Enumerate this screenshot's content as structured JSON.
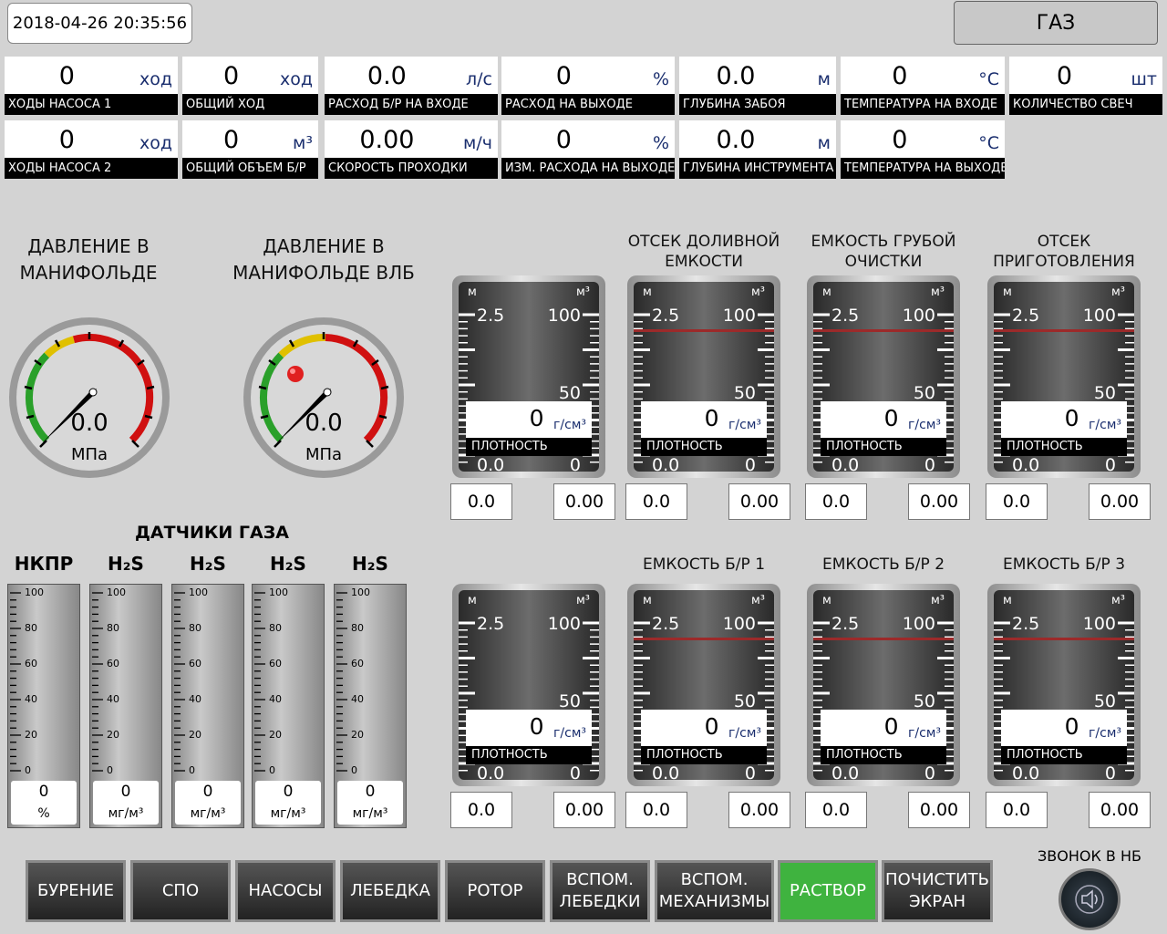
{
  "header": {
    "datetime": "2018-04-26 20:35:56",
    "gas_button": "ГАЗ"
  },
  "tiles_row1": [
    {
      "value": "0",
      "unit": "ход",
      "label": "ХОДЫ НАСОСА 1"
    },
    {
      "value": "0",
      "unit": "ход",
      "label": "ОБЩИЙ ХОД"
    },
    {
      "value": "0.0",
      "unit": "л/с",
      "label": "РАСХОД Б/Р НА ВХОДЕ"
    },
    {
      "value": "0",
      "unit": "%",
      "label": "РАСХОД НА ВЫХОДЕ"
    },
    {
      "value": "0.0",
      "unit": "м",
      "label": "ГЛУБИНА ЗАБОЯ"
    },
    {
      "value": "0",
      "unit": "°C",
      "label": "ТЕМПЕРАТУРА НА ВХОДЕ"
    },
    {
      "value": "0",
      "unit": "шт",
      "label": "КОЛИЧЕСТВО СВЕЧ"
    }
  ],
  "tiles_row2": [
    {
      "value": "0",
      "unit": "ход",
      "label": "ХОДЫ НАСОСА 2"
    },
    {
      "value": "0",
      "unit": "м³",
      "label": "ОБЩИЙ ОБЪЕМ Б/Р"
    },
    {
      "value": "0.00",
      "unit": "м/ч",
      "label": "СКОРОСТЬ ПРОХОДКИ"
    },
    {
      "value": "0",
      "unit": "%",
      "label": "ИЗМ. РАСХОДА НА ВЫХОДЕ"
    },
    {
      "value": "0.0",
      "unit": "м",
      "label": "ГЛУБИНА ИНСТРУМЕНТА"
    },
    {
      "value": "0",
      "unit": "°C",
      "label": "ТЕМПЕРАТУРА НА ВЫХОДЕ"
    }
  ],
  "gauges": [
    {
      "title": "ДАВЛЕНИЕ В МАНИФОЛЬДЕ",
      "value": "0.0",
      "unit": "МПа"
    },
    {
      "title": "ДАВЛЕНИЕ В МАНИФОЛЬДЕ ВЛБ",
      "value": "0.0",
      "unit": "МПа"
    }
  ],
  "tank_common": {
    "unit_left": "м",
    "unit_right": "м³",
    "level_top": "2.5",
    "vol_top": "100",
    "vol_mid": "50",
    "level_bottom": "0.0",
    "vol_bottom": "0",
    "density_unit": "г/см³",
    "density_label": "ПЛОТНОСТЬ"
  },
  "tanks": [
    {
      "title": "",
      "density": "0",
      "level": "0.0",
      "volume": "0.00"
    },
    {
      "title": "ОТСЕК ДОЛИВНОЙ ЕМКОСТИ",
      "density": "0",
      "level": "0.0",
      "volume": "0.00"
    },
    {
      "title": "ЕМКОСТЬ ГРУБОЙ ОЧИСТКИ",
      "density": "0",
      "level": "0.0",
      "volume": "0.00"
    },
    {
      "title": "ОТСЕК ПРИГОТОВЛЕНИЯ",
      "density": "0",
      "level": "0.0",
      "volume": "0.00"
    },
    {
      "title": "",
      "density": "0",
      "level": "0.0",
      "volume": "0.00"
    },
    {
      "title": "ЕМКОСТЬ Б/Р 1",
      "density": "0",
      "level": "0.0",
      "volume": "0.00"
    },
    {
      "title": "ЕМКОСТЬ Б/Р 2",
      "density": "0",
      "level": "0.0",
      "volume": "0.00"
    },
    {
      "title": "ЕМКОСТЬ Б/Р 3",
      "density": "0",
      "level": "0.0",
      "volume": "0.00"
    }
  ],
  "gas_sensors": {
    "title": "ДАТЧИКИ ГАЗА",
    "scale": [
      "100",
      "80",
      "60",
      "40",
      "20",
      "0"
    ],
    "items": [
      {
        "name": "НКПР",
        "value": "0",
        "unit": "%"
      },
      {
        "name": "H₂S",
        "value": "0",
        "unit": "мг/м³"
      },
      {
        "name": "H₂S",
        "value": "0",
        "unit": "мг/м³"
      },
      {
        "name": "H₂S",
        "value": "0",
        "unit": "мг/м³"
      },
      {
        "name": "H₂S",
        "value": "0",
        "unit": "мг/м³"
      }
    ]
  },
  "nav": [
    {
      "label": "БУРЕНИЕ",
      "active": false
    },
    {
      "label": "СПО",
      "active": false
    },
    {
      "label": "НАСОСЫ",
      "active": false
    },
    {
      "label": "ЛЕБЕДКА",
      "active": false
    },
    {
      "label": "РОТОР",
      "active": false
    },
    {
      "label": "ВСПОМ. ЛЕБЕДКИ",
      "active": false
    },
    {
      "label": "ВСПОМ. МЕХАНИЗМЫ",
      "active": false
    },
    {
      "label": "РАСТВОР",
      "active": true
    },
    {
      "label": "ПОЧИСТИТЬ ЭКРАН",
      "active": false
    }
  ],
  "bell": {
    "label": "ЗВОНОК В НБ"
  }
}
